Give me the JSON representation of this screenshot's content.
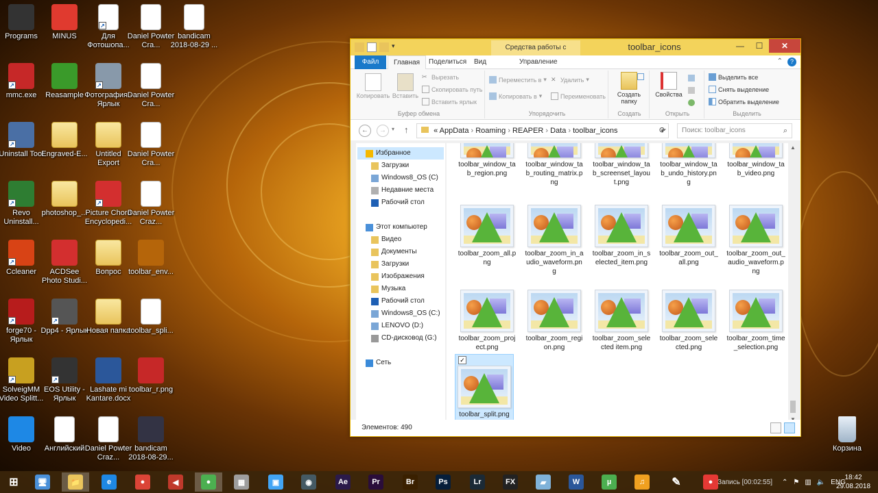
{
  "desktop": {
    "icons": [
      {
        "label": "Programs",
        "icon": "programs-icon",
        "color": "#333333",
        "shortcut": false
      },
      {
        "label": "MINUS",
        "icon": "power-icon",
        "color": "#e03a2f",
        "shortcut": false
      },
      {
        "label": "Для Фотошопа...",
        "icon": "forbidden-icon",
        "color": "#ffffff",
        "shortcut": true
      },
      {
        "label": "Daniel Powter Cra...",
        "icon": "audio-file-icon",
        "color": "#ffffff",
        "shortcut": false
      },
      {
        "label": "bandicam 2018-08-29 ...",
        "icon": "audio-file-icon",
        "color": "#ffffff",
        "shortcut": false
      },
      {
        "label": "mmc.exe",
        "icon": "mmc-icon",
        "color": "#c62828",
        "shortcut": true
      },
      {
        "label": "Reasample",
        "icon": "arrow-icon",
        "color": "#3a9a2a",
        "shortcut": false
      },
      {
        "label": "Фотография - Ярлык",
        "icon": "camera-icon",
        "color": "#8899aa",
        "shortcut": true
      },
      {
        "label": "Daniel Powter Cra...",
        "icon": "document-icon",
        "color": "#ffffff",
        "shortcut": false
      },
      {
        "label": "Uninstall Tool",
        "icon": "trash-icon",
        "color": "#4a6fa5",
        "shortcut": true
      },
      {
        "label": "Engraved-E...",
        "icon": "folder-icon",
        "color": "#e9c45c",
        "shortcut": false
      },
      {
        "label": "Untitled Export",
        "icon": "folder-icon",
        "color": "#e9c45c",
        "shortcut": false
      },
      {
        "label": "Daniel Powter Cra...",
        "icon": "audio-file-icon",
        "color": "#ffffff",
        "shortcut": false
      },
      {
        "label": "Revo Uninstall...",
        "icon": "revo-icon",
        "color": "#2e7d32",
        "shortcut": true
      },
      {
        "label": "photoshop_...",
        "icon": "folder-icon",
        "color": "#e9c45c",
        "shortcut": false
      },
      {
        "label": "Picture Chord Encyclopedi...",
        "icon": "pdf-icon",
        "color": "#d32f2f",
        "shortcut": true
      },
      {
        "label": "Daniel Powter Craz...",
        "icon": "audio-file-icon",
        "color": "#ffffff",
        "shortcut": false
      },
      {
        "label": "Ccleaner",
        "icon": "ccleaner-icon",
        "color": "#d84315",
        "shortcut": true
      },
      {
        "label": "ACDSee Photo Studi...",
        "icon": "acdsee-icon",
        "color": "#d32f2f",
        "shortcut": false
      },
      {
        "label": "Вопрос",
        "icon": "folder-icon",
        "color": "#e9c45c",
        "shortcut": false
      },
      {
        "label": "toolbar_env...",
        "icon": "image-file-icon",
        "color": "#b5650a",
        "shortcut": false
      },
      {
        "label": "forge70 - Ярлык",
        "icon": "forge-icon",
        "color": "#b71c1c",
        "shortcut": true
      },
      {
        "label": "Dpp4 - Ярлык",
        "icon": "dpp-icon",
        "color": "#555555",
        "shortcut": true
      },
      {
        "label": "Новая папка",
        "icon": "folder-icon",
        "color": "#e9c45c",
        "shortcut": false
      },
      {
        "label": "toolbar_spli...",
        "icon": "image-file-icon",
        "color": "#ffffff",
        "shortcut": false
      },
      {
        "label": "SolveigMM Video Splitt...",
        "icon": "solveig-icon",
        "color": "#c8a020",
        "shortcut": true
      },
      {
        "label": "EOS Utility - Ярлык",
        "icon": "eos-icon",
        "color": "#333333",
        "shortcut": true
      },
      {
        "label": "Lashate mi Kantare.docx",
        "icon": "word-icon",
        "color": "#2b579a",
        "shortcut": false
      },
      {
        "label": "toolbar_r.png",
        "icon": "image-file-icon",
        "color": "#c62828",
        "shortcut": false
      },
      {
        "label": "Video",
        "icon": "download-icon",
        "color": "#1e88e5",
        "shortcut": false
      },
      {
        "label": "Английский",
        "icon": "acrobat-icon",
        "color": "#ffffff",
        "shortcut": false
      },
      {
        "label": "Daniel Powter Craz...",
        "icon": "document-icon",
        "color": "#ffffff",
        "shortcut": false
      },
      {
        "label": "bandicam 2018-08-29...",
        "icon": "avi-icon",
        "color": "#333344",
        "shortcut": false
      }
    ],
    "recycle_bin": {
      "label": "Корзина",
      "icon": "recycle-bin-icon"
    }
  },
  "explorer": {
    "context_tab": "Средства работы с рисунками",
    "title": "toolbar_icons",
    "window_buttons": {
      "minimize": "—",
      "maximize": "☐",
      "close": "✕"
    },
    "tabs": [
      "Файл",
      "Главная",
      "Поделиться",
      "Вид",
      "Управление"
    ],
    "ribbon": {
      "clipboard": {
        "name": "Буфер обмена",
        "copy": "Копировать",
        "paste": "Вставить",
        "cut": "Вырезать",
        "copy_path": "Скопировать путь",
        "paste_shortcut": "Вставить ярлык"
      },
      "organize": {
        "name": "Упорядочить",
        "move_to": "Переместить в",
        "copy_to": "Копировать в",
        "delete": "Удалить",
        "rename": "Переименовать"
      },
      "new": {
        "name": "Создать",
        "new_folder": "Создать папку"
      },
      "open": {
        "name": "Открыть",
        "properties": "Свойства"
      },
      "select": {
        "name": "Выделить",
        "select_all": "Выделить все",
        "select_none": "Снять выделение",
        "invert": "Обратить выделение"
      }
    },
    "address": {
      "path": [
        "AppData",
        "Roaming",
        "REAPER",
        "Data",
        "toolbar_icons"
      ],
      "prefix": "«"
    },
    "search": {
      "placeholder": "Поиск: toolbar_icons"
    },
    "nav": [
      {
        "label": "Избранное",
        "icon": "star-icon",
        "level": 0
      },
      {
        "label": "Загрузки",
        "icon": "downloads-icon",
        "level": 1
      },
      {
        "label": "Windows8_OS (C)",
        "icon": "drive-icon",
        "level": 1
      },
      {
        "label": "Недавние места",
        "icon": "recent-icon",
        "level": 1
      },
      {
        "label": "Рабочий стол",
        "icon": "desktop-icon",
        "level": 1
      },
      {
        "label": "Этот компьютер",
        "icon": "computer-icon",
        "level": 0
      },
      {
        "label": "Видео",
        "icon": "video-folder-icon",
        "level": 1
      },
      {
        "label": "Документы",
        "icon": "documents-icon",
        "level": 1
      },
      {
        "label": "Загрузки",
        "icon": "downloads-icon",
        "level": 1
      },
      {
        "label": "Изображения",
        "icon": "pictures-icon",
        "level": 1
      },
      {
        "label": "Музыка",
        "icon": "music-icon",
        "level": 1
      },
      {
        "label": "Рабочий стол",
        "icon": "desktop-icon",
        "level": 1
      },
      {
        "label": "Windows8_OS (C:)",
        "icon": "drive-icon",
        "level": 1
      },
      {
        "label": "LENOVO (D:)",
        "icon": "drive-icon",
        "level": 1
      },
      {
        "label": "CD-дисковод (G:)",
        "icon": "cd-drive-icon",
        "level": 1
      },
      {
        "label": "Сеть",
        "icon": "network-icon",
        "level": 0
      }
    ],
    "files": [
      "toolbar_window_tab_region.png",
      "toolbar_window_tab_routing_matrix.png",
      "toolbar_window_tab_screenset_layout.png",
      "toolbar_window_tab_undo_history.png",
      "toolbar_window_tab_video.png",
      "toolbar_zoom_all.png",
      "toolbar_zoom_in_audio_waveform.png",
      "toolbar_zoom_in_selected_item.png",
      "toolbar_zoom_out_all.png",
      "toolbar_zoom_out_audio_waveform.png",
      "toolbar_zoom_project.png",
      "toolbar_zoom_region.png",
      "toolbar_zoom_selected item.png",
      "toolbar_zoom_selected.png",
      "toolbar_zoom_time_selection.png",
      "toolbar_split.png"
    ],
    "selected_file_index": 15,
    "status": "Элементов: 490"
  },
  "taskbar": {
    "apps": [
      {
        "name": "start-button",
        "glyph": "⊞",
        "color": "#ffffff"
      },
      {
        "name": "computer",
        "glyph": "🖥",
        "color": "#4a90d9"
      },
      {
        "name": "file-explorer",
        "glyph": "📁",
        "color": "#e9c45c"
      },
      {
        "name": "internet-explorer",
        "glyph": "e",
        "color": "#1e88e5"
      },
      {
        "name": "chrome",
        "glyph": "●",
        "color": "#db4437"
      },
      {
        "name": "reaper",
        "glyph": "◀",
        "color": "#c0392b"
      },
      {
        "name": "chrome-app",
        "glyph": "●",
        "color": "#4caf50"
      },
      {
        "name": "calculator",
        "glyph": "▦",
        "color": "#9e9e9e"
      },
      {
        "name": "control-panel",
        "glyph": "▣",
        "color": "#42a5f5"
      },
      {
        "name": "davinci",
        "glyph": "◉",
        "color": "#455a64"
      },
      {
        "name": "after-effects",
        "glyph": "Ae",
        "color": "#2b1a4a"
      },
      {
        "name": "premiere",
        "glyph": "Pr",
        "color": "#2a0d3a"
      },
      {
        "name": "bridge",
        "glyph": "Br",
        "color": "#3a2000"
      },
      {
        "name": "photoshop",
        "glyph": "Ps",
        "color": "#061e3a"
      },
      {
        "name": "lightroom",
        "glyph": "Lr",
        "color": "#1b2a36"
      },
      {
        "name": "fx",
        "glyph": "FX",
        "color": "#222222"
      },
      {
        "name": "app-tile",
        "glyph": "▰",
        "color": "#7fb2d9"
      },
      {
        "name": "word",
        "glyph": "W",
        "color": "#2b579a"
      },
      {
        "name": "utorrent",
        "glyph": "µ",
        "color": "#4caf50"
      },
      {
        "name": "music-app",
        "glyph": "♫",
        "color": "#f0a020"
      },
      {
        "name": "tool-app",
        "glyph": "✎",
        "color": "#ffffff"
      },
      {
        "name": "bandicam",
        "glyph": "●",
        "color": "#e53935"
      }
    ],
    "recording_text": "Запись [00:02:55]",
    "language": "ENG",
    "time": "18:42",
    "date": "29.08.2018"
  }
}
